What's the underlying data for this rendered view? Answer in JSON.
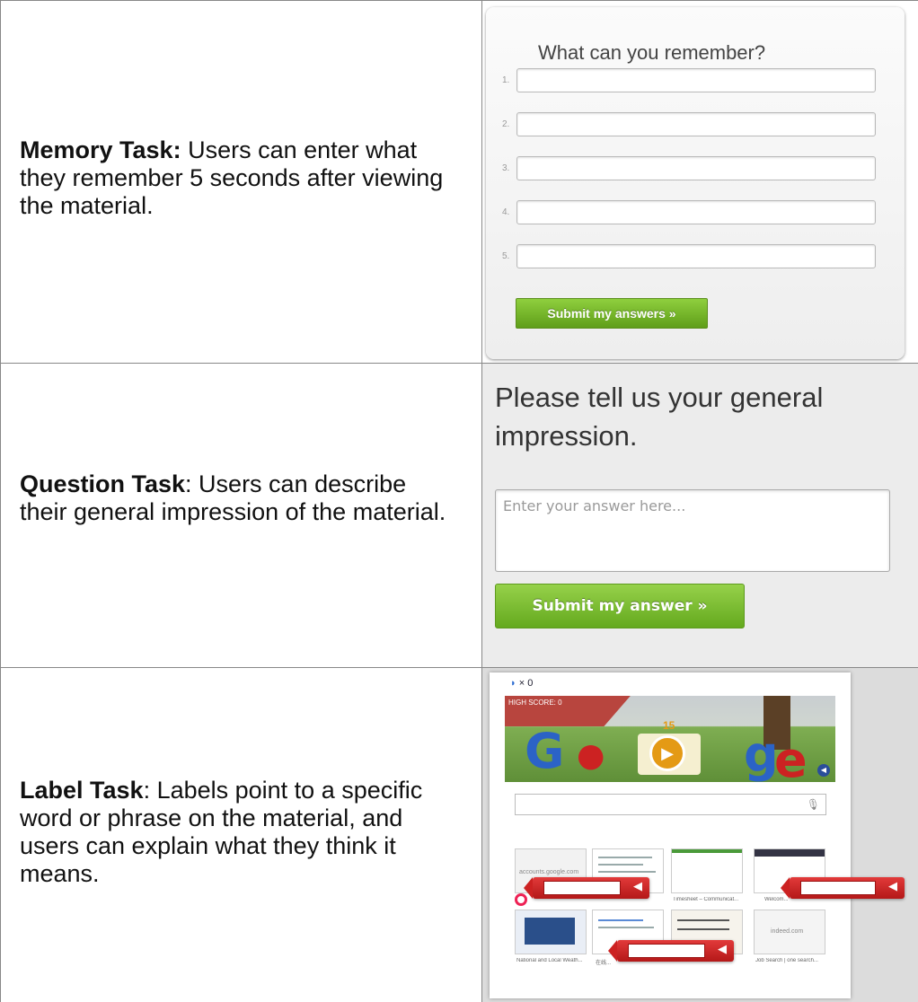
{
  "rows": [
    {
      "title": "Memory Task:",
      "desc": " Users can enter what they remember 5 seconds after viewing the material."
    },
    {
      "title": "Question Task",
      "desc": ": Users can describe their general impression of the material."
    },
    {
      "title": "Label Task",
      "desc": ": Labels point to a specific word or phrase on the material, and users can explain what they think it means."
    }
  ],
  "memory": {
    "heading": "What can you remember?",
    "numbers": [
      "1.",
      "2.",
      "3.",
      "4.",
      "5."
    ],
    "submit_label": "Submit my answers »"
  },
  "question": {
    "heading": "Please tell us your general impression.",
    "placeholder": "Enter your answer here...",
    "submit_label": "Submit my answer »"
  },
  "label_task": {
    "lives": "× 0",
    "high_score": "HIGH SCORE: 0",
    "cake_number": "15",
    "thumbnails": [
      {
        "caption": "G...",
        "inner": "accounts.google.com"
      },
      {
        "caption": "",
        "inner": ""
      },
      {
        "caption": "Timesheet – Communicat...",
        "inner": ""
      },
      {
        "caption": "Welcom...",
        "inner": ""
      },
      {
        "caption": "National and Local Weath...",
        "inner": ""
      },
      {
        "caption": "在线...",
        "inner": ""
      },
      {
        "caption": "",
        "inner": ""
      },
      {
        "caption": "Job Search | one search...",
        "inner": "indeed.com"
      }
    ]
  },
  "colors": {
    "button_green": "#6fb523",
    "label_red": "#c42020",
    "grid_line": "#888888"
  }
}
